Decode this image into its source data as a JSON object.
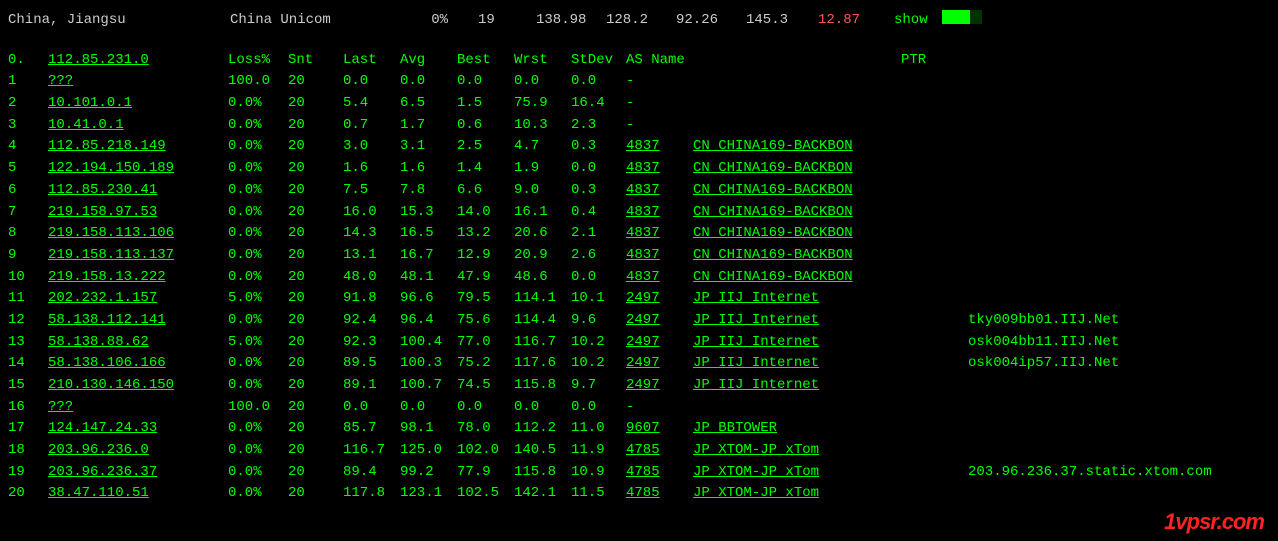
{
  "top": {
    "location": "China, Jiangsu",
    "isp": "China Unicom",
    "pct": "0%",
    "n": "19",
    "v1": "138.98",
    "v2": "128.2",
    "v3": "92.26",
    "v4": "145.3",
    "v5": "12.87",
    "show": "show"
  },
  "headers": {
    "hop": "0.",
    "ip": "112.85.231.0",
    "loss": "Loss%",
    "snt": "Snt",
    "last": "Last",
    "avg": "Avg",
    "best": "Best",
    "wrst": "Wrst",
    "stdev": "StDev",
    "asname": "AS Name",
    "ptr": "PTR"
  },
  "rows": [
    {
      "hop": "1",
      "ip": "???",
      "loss": "100.0",
      "snt": "20",
      "last": "0.0",
      "avg": "0.0",
      "best": "0.0",
      "wrst": "0.0",
      "stdev": "0.0",
      "asn": "-",
      "asname": "",
      "ptr": ""
    },
    {
      "hop": "2",
      "ip": "10.101.0.1",
      "loss": "0.0%",
      "snt": "20",
      "last": "5.4",
      "avg": "6.5",
      "best": "1.5",
      "wrst": "75.9",
      "stdev": "16.4",
      "asn": "-",
      "asname": "",
      "ptr": ""
    },
    {
      "hop": "3",
      "ip": "10.41.0.1",
      "loss": "0.0%",
      "snt": "20",
      "last": "0.7",
      "avg": "1.7",
      "best": "0.6",
      "wrst": "10.3",
      "stdev": "2.3",
      "asn": "-",
      "asname": "",
      "ptr": ""
    },
    {
      "hop": "4",
      "ip": "112.85.218.149",
      "loss": "0.0%",
      "snt": "20",
      "last": "3.0",
      "avg": "3.1",
      "best": "2.5",
      "wrst": "4.7",
      "stdev": "0.3",
      "asn": "4837",
      "asname": "CN CHINA169-BACKBON",
      "ptr": ""
    },
    {
      "hop": "5",
      "ip": "122.194.150.189",
      "loss": "0.0%",
      "snt": "20",
      "last": "1.6",
      "avg": "1.6",
      "best": "1.4",
      "wrst": "1.9",
      "stdev": "0.0",
      "asn": "4837",
      "asname": "CN CHINA169-BACKBON",
      "ptr": ""
    },
    {
      "hop": "6",
      "ip": "112.85.230.41",
      "loss": "0.0%",
      "snt": "20",
      "last": "7.5",
      "avg": "7.8",
      "best": "6.6",
      "wrst": "9.0",
      "stdev": "0.3",
      "asn": "4837",
      "asname": "CN CHINA169-BACKBON",
      "ptr": ""
    },
    {
      "hop": "7",
      "ip": "219.158.97.53",
      "loss": "0.0%",
      "snt": "20",
      "last": "16.0",
      "avg": "15.3",
      "best": "14.0",
      "wrst": "16.1",
      "stdev": "0.4",
      "asn": "4837",
      "asname": "CN CHINA169-BACKBON",
      "ptr": ""
    },
    {
      "hop": "8",
      "ip": "219.158.113.106",
      "loss": "0.0%",
      "snt": "20",
      "last": "14.3",
      "avg": "16.5",
      "best": "13.2",
      "wrst": "20.6",
      "stdev": "2.1",
      "asn": "4837",
      "asname": "CN CHINA169-BACKBON",
      "ptr": ""
    },
    {
      "hop": "9",
      "ip": "219.158.113.137",
      "loss": "0.0%",
      "snt": "20",
      "last": "13.1",
      "avg": "16.7",
      "best": "12.9",
      "wrst": "20.9",
      "stdev": "2.6",
      "asn": "4837",
      "asname": "CN CHINA169-BACKBON",
      "ptr": ""
    },
    {
      "hop": "10",
      "ip": "219.158.13.222",
      "loss": "0.0%",
      "snt": "20",
      "last": "48.0",
      "avg": "48.1",
      "best": "47.9",
      "wrst": "48.6",
      "stdev": "0.0",
      "asn": "4837",
      "asname": "CN CHINA169-BACKBON",
      "ptr": ""
    },
    {
      "hop": "11",
      "ip": "202.232.1.157",
      "loss": "5.0%",
      "snt": "20",
      "last": "91.8",
      "avg": "96.6",
      "best": "79.5",
      "wrst": "114.1",
      "stdev": "10.1",
      "asn": "2497",
      "asname": "JP IIJ Internet",
      "ptr": ""
    },
    {
      "hop": "12",
      "ip": "58.138.112.141",
      "loss": "0.0%",
      "snt": "20",
      "last": "92.4",
      "avg": "96.4",
      "best": "75.6",
      "wrst": "114.4",
      "stdev": "9.6",
      "asn": "2497",
      "asname": "JP IIJ Internet",
      "ptr": "tky009bb01.IIJ.Net"
    },
    {
      "hop": "13",
      "ip": "58.138.88.62",
      "loss": "5.0%",
      "snt": "20",
      "last": "92.3",
      "avg": "100.4",
      "best": "77.0",
      "wrst": "116.7",
      "stdev": "10.2",
      "asn": "2497",
      "asname": "JP IIJ Internet",
      "ptr": "osk004bb11.IIJ.Net"
    },
    {
      "hop": "14",
      "ip": "58.138.106.166",
      "loss": "0.0%",
      "snt": "20",
      "last": "89.5",
      "avg": "100.3",
      "best": "75.2",
      "wrst": "117.6",
      "stdev": "10.2",
      "asn": "2497",
      "asname": "JP IIJ Internet",
      "ptr": "osk004ip57.IIJ.Net"
    },
    {
      "hop": "15",
      "ip": "210.130.146.150",
      "loss": "0.0%",
      "snt": "20",
      "last": "89.1",
      "avg": "100.7",
      "best": "74.5",
      "wrst": "115.8",
      "stdev": "9.7",
      "asn": "2497",
      "asname": "JP IIJ Internet",
      "ptr": ""
    },
    {
      "hop": "16",
      "ip": "???",
      "loss": "100.0",
      "snt": "20",
      "last": "0.0",
      "avg": "0.0",
      "best": "0.0",
      "wrst": "0.0",
      "stdev": "0.0",
      "asn": "-",
      "asname": "",
      "ptr": ""
    },
    {
      "hop": "17",
      "ip": "124.147.24.33",
      "loss": "0.0%",
      "snt": "20",
      "last": "85.7",
      "avg": "98.1",
      "best": "78.0",
      "wrst": "112.2",
      "stdev": "11.0",
      "asn": "9607",
      "asname": "JP BBTOWER",
      "ptr": ""
    },
    {
      "hop": "18",
      "ip": "203.96.236.0",
      "loss": "0.0%",
      "snt": "20",
      "last": "116.7",
      "avg": "125.0",
      "best": "102.0",
      "wrst": "140.5",
      "stdev": "11.9",
      "asn": "4785",
      "asname": "JP XTOM-JP xTom",
      "ptr": ""
    },
    {
      "hop": "19",
      "ip": "203.96.236.37",
      "loss": "0.0%",
      "snt": "20",
      "last": "89.4",
      "avg": "99.2",
      "best": "77.9",
      "wrst": "115.8",
      "stdev": "10.9",
      "asn": "4785",
      "asname": "JP XTOM-JP xTom",
      "ptr": "203.96.236.37.static.xtom.com"
    },
    {
      "hop": "20",
      "ip": "38.47.110.51",
      "loss": "0.0%",
      "snt": "20",
      "last": "117.8",
      "avg": "123.1",
      "best": "102.5",
      "wrst": "142.1",
      "stdev": "11.5",
      "asn": "4785",
      "asname": "JP XTOM-JP xTom",
      "ptr": ""
    }
  ],
  "watermark": "1vpsr.com"
}
